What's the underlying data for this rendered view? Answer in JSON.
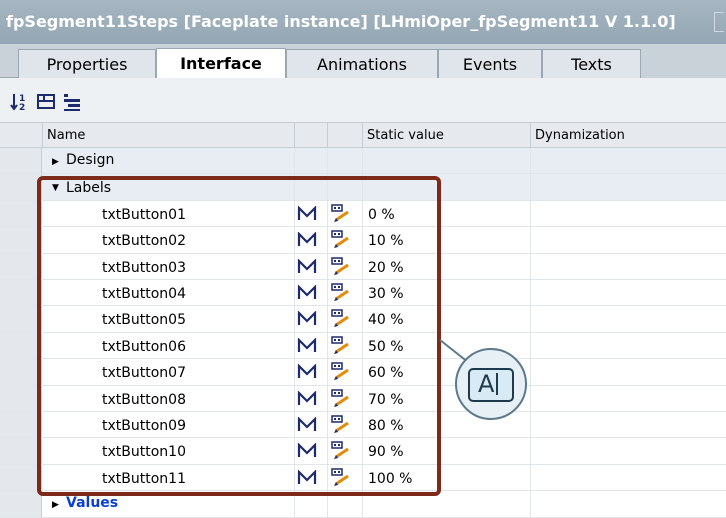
{
  "window": {
    "title": "fpSegment11Steps [Faceplate instance] [LHmiOper_fpSegment11 V 1.1.0]"
  },
  "tabs": [
    {
      "label": "Properties",
      "active": false
    },
    {
      "label": "Interface",
      "active": true
    },
    {
      "label": "Animations",
      "active": false
    },
    {
      "label": "Events",
      "active": false
    },
    {
      "label": "Texts",
      "active": false
    }
  ],
  "toolbar": {
    "icons": [
      "sort-icon",
      "expand-all-icon",
      "collapse-all-icon"
    ]
  },
  "table": {
    "columns": {
      "name": "Name",
      "static_value": "Static value",
      "dynamization": "Dynamization"
    },
    "groups": {
      "design": "Design",
      "labels": "Labels",
      "values": "Values"
    },
    "label_rows": [
      {
        "name": "txtButton01",
        "value": "0 %"
      },
      {
        "name": "txtButton02",
        "value": "10 %"
      },
      {
        "name": "txtButton03",
        "value": "20 %"
      },
      {
        "name": "txtButton04",
        "value": "30 %"
      },
      {
        "name": "txtButton05",
        "value": "40 %"
      },
      {
        "name": "txtButton06",
        "value": "50 %"
      },
      {
        "name": "txtButton07",
        "value": "60 %"
      },
      {
        "name": "txtButton08",
        "value": "70 %"
      },
      {
        "name": "txtButton09",
        "value": "80 %"
      },
      {
        "name": "txtButton10",
        "value": "90 %"
      },
      {
        "name": "txtButton11",
        "value": "100 %"
      }
    ]
  },
  "callout": {
    "icon": "text-edit-icon",
    "glyph": "A"
  },
  "colors": {
    "highlight_border": "#7e2a1b",
    "values_link": "#0b3fd1",
    "title_bar": "#9aacb8"
  }
}
